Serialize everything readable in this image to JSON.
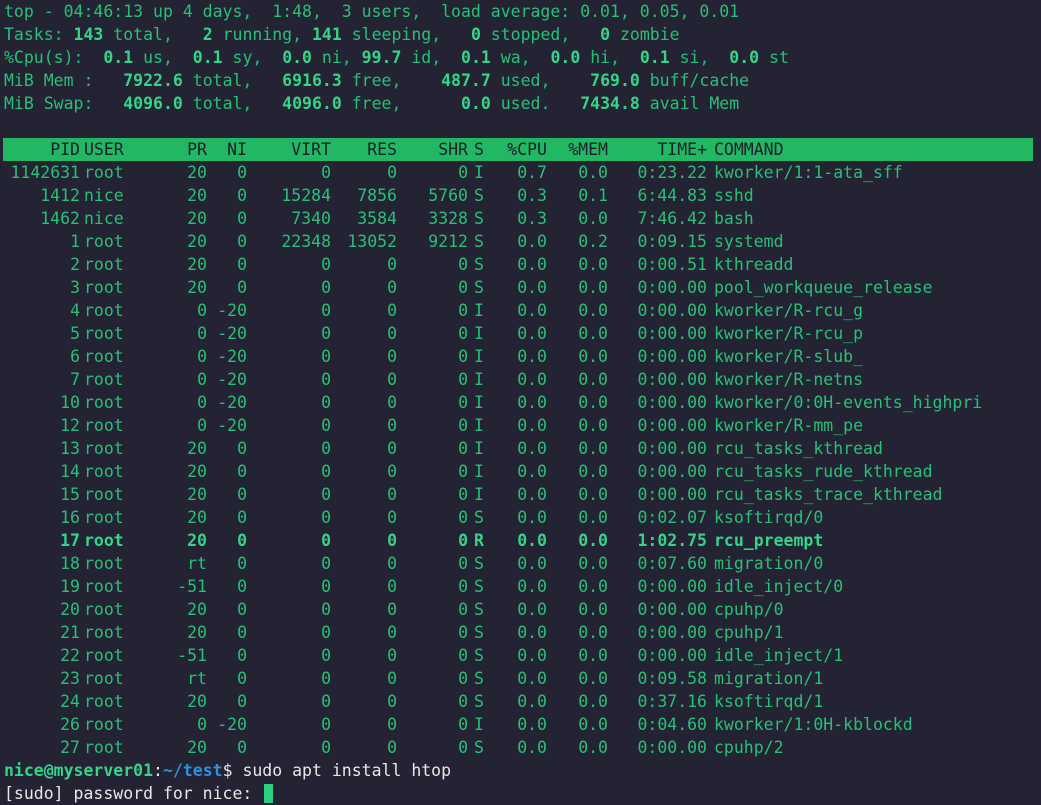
{
  "summary": {
    "line1": {
      "prefix": "top - 04:46:13 up 4 days,  1:48,  3 users,  load average: 0.01, 0.05, 0.01"
    },
    "line2": {
      "label": "Tasks:",
      "total": "143",
      "total_label": " total,   ",
      "running": "2",
      "running_label": " running, ",
      "sleeping": "141",
      "sleeping_label": " sleeping,   ",
      "stopped": "0",
      "stopped_label": " stopped,   ",
      "zombie": "0",
      "zombie_label": " zombie"
    },
    "line3": {
      "label": "%Cpu(s):  ",
      "us": "0.1",
      "us_label": " us,  ",
      "sy": "0.1",
      "sy_label": " sy,  ",
      "ni": "0.0",
      "ni_label": " ni, ",
      "id": "99.7",
      "id_label": " id,  ",
      "wa": "0.1",
      "wa_label": " wa,  ",
      "hi": "0.0",
      "hi_label": " hi,  ",
      "si": "0.1",
      "si_label": " si,  ",
      "st": "0.0",
      "st_label": " st"
    },
    "line4": {
      "label": "MiB Mem :   ",
      "total": "7922.6",
      "total_label": " total,   ",
      "free": "6916.3",
      "free_label": " free,    ",
      "used": "487.7",
      "used_label": " used,    ",
      "buff": "769.0",
      "buff_label": " buff/cache"
    },
    "line5": {
      "label": "MiB Swap:   ",
      "total": "4096.0",
      "total_label": " total,   ",
      "free": "4096.0",
      "free_label": " free,      ",
      "used": "0.0",
      "used_label": " used.   ",
      "avail": "7434.8",
      "avail_label": " avail Mem"
    }
  },
  "columns": [
    "PID",
    "USER",
    "PR",
    "NI",
    "VIRT",
    "RES",
    "SHR",
    "S",
    "%CPU",
    "%MEM",
    "TIME+",
    "COMMAND"
  ],
  "processes": [
    {
      "pid": "1142631",
      "user": "root",
      "pr": "20",
      "ni": "0",
      "virt": "0",
      "res": "0",
      "shr": "0",
      "s": "I",
      "cpu": "0.7",
      "mem": "0.0",
      "time": "0:23.22",
      "cmd": "kworker/1:1-ata_sff",
      "bold": false
    },
    {
      "pid": "1412",
      "user": "nice",
      "pr": "20",
      "ni": "0",
      "virt": "15284",
      "res": "7856",
      "shr": "5760",
      "s": "S",
      "cpu": "0.3",
      "mem": "0.1",
      "time": "6:44.83",
      "cmd": "sshd",
      "bold": false
    },
    {
      "pid": "1462",
      "user": "nice",
      "pr": "20",
      "ni": "0",
      "virt": "7340",
      "res": "3584",
      "shr": "3328",
      "s": "S",
      "cpu": "0.3",
      "mem": "0.0",
      "time": "7:46.42",
      "cmd": "bash",
      "bold": false
    },
    {
      "pid": "1",
      "user": "root",
      "pr": "20",
      "ni": "0",
      "virt": "22348",
      "res": "13052",
      "shr": "9212",
      "s": "S",
      "cpu": "0.0",
      "mem": "0.2",
      "time": "0:09.15",
      "cmd": "systemd",
      "bold": false
    },
    {
      "pid": "2",
      "user": "root",
      "pr": "20",
      "ni": "0",
      "virt": "0",
      "res": "0",
      "shr": "0",
      "s": "S",
      "cpu": "0.0",
      "mem": "0.0",
      "time": "0:00.51",
      "cmd": "kthreadd",
      "bold": false
    },
    {
      "pid": "3",
      "user": "root",
      "pr": "20",
      "ni": "0",
      "virt": "0",
      "res": "0",
      "shr": "0",
      "s": "S",
      "cpu": "0.0",
      "mem": "0.0",
      "time": "0:00.00",
      "cmd": "pool_workqueue_release",
      "bold": false
    },
    {
      "pid": "4",
      "user": "root",
      "pr": "0",
      "ni": "-20",
      "virt": "0",
      "res": "0",
      "shr": "0",
      "s": "I",
      "cpu": "0.0",
      "mem": "0.0",
      "time": "0:00.00",
      "cmd": "kworker/R-rcu_g",
      "bold": false
    },
    {
      "pid": "5",
      "user": "root",
      "pr": "0",
      "ni": "-20",
      "virt": "0",
      "res": "0",
      "shr": "0",
      "s": "I",
      "cpu": "0.0",
      "mem": "0.0",
      "time": "0:00.00",
      "cmd": "kworker/R-rcu_p",
      "bold": false
    },
    {
      "pid": "6",
      "user": "root",
      "pr": "0",
      "ni": "-20",
      "virt": "0",
      "res": "0",
      "shr": "0",
      "s": "I",
      "cpu": "0.0",
      "mem": "0.0",
      "time": "0:00.00",
      "cmd": "kworker/R-slub_",
      "bold": false
    },
    {
      "pid": "7",
      "user": "root",
      "pr": "0",
      "ni": "-20",
      "virt": "0",
      "res": "0",
      "shr": "0",
      "s": "I",
      "cpu": "0.0",
      "mem": "0.0",
      "time": "0:00.00",
      "cmd": "kworker/R-netns",
      "bold": false
    },
    {
      "pid": "10",
      "user": "root",
      "pr": "0",
      "ni": "-20",
      "virt": "0",
      "res": "0",
      "shr": "0",
      "s": "I",
      "cpu": "0.0",
      "mem": "0.0",
      "time": "0:00.00",
      "cmd": "kworker/0:0H-events_highpri",
      "bold": false
    },
    {
      "pid": "12",
      "user": "root",
      "pr": "0",
      "ni": "-20",
      "virt": "0",
      "res": "0",
      "shr": "0",
      "s": "I",
      "cpu": "0.0",
      "mem": "0.0",
      "time": "0:00.00",
      "cmd": "kworker/R-mm_pe",
      "bold": false
    },
    {
      "pid": "13",
      "user": "root",
      "pr": "20",
      "ni": "0",
      "virt": "0",
      "res": "0",
      "shr": "0",
      "s": "I",
      "cpu": "0.0",
      "mem": "0.0",
      "time": "0:00.00",
      "cmd": "rcu_tasks_kthread",
      "bold": false
    },
    {
      "pid": "14",
      "user": "root",
      "pr": "20",
      "ni": "0",
      "virt": "0",
      "res": "0",
      "shr": "0",
      "s": "I",
      "cpu": "0.0",
      "mem": "0.0",
      "time": "0:00.00",
      "cmd": "rcu_tasks_rude_kthread",
      "bold": false
    },
    {
      "pid": "15",
      "user": "root",
      "pr": "20",
      "ni": "0",
      "virt": "0",
      "res": "0",
      "shr": "0",
      "s": "I",
      "cpu": "0.0",
      "mem": "0.0",
      "time": "0:00.00",
      "cmd": "rcu_tasks_trace_kthread",
      "bold": false
    },
    {
      "pid": "16",
      "user": "root",
      "pr": "20",
      "ni": "0",
      "virt": "0",
      "res": "0",
      "shr": "0",
      "s": "S",
      "cpu": "0.0",
      "mem": "0.0",
      "time": "0:02.07",
      "cmd": "ksoftirqd/0",
      "bold": false
    },
    {
      "pid": "17",
      "user": "root",
      "pr": "20",
      "ni": "0",
      "virt": "0",
      "res": "0",
      "shr": "0",
      "s": "R",
      "cpu": "0.0",
      "mem": "0.0",
      "time": "1:02.75",
      "cmd": "rcu_preempt",
      "bold": true
    },
    {
      "pid": "18",
      "user": "root",
      "pr": "rt",
      "ni": "0",
      "virt": "0",
      "res": "0",
      "shr": "0",
      "s": "S",
      "cpu": "0.0",
      "mem": "0.0",
      "time": "0:07.60",
      "cmd": "migration/0",
      "bold": false
    },
    {
      "pid": "19",
      "user": "root",
      "pr": "-51",
      "ni": "0",
      "virt": "0",
      "res": "0",
      "shr": "0",
      "s": "S",
      "cpu": "0.0",
      "mem": "0.0",
      "time": "0:00.00",
      "cmd": "idle_inject/0",
      "bold": false
    },
    {
      "pid": "20",
      "user": "root",
      "pr": "20",
      "ni": "0",
      "virt": "0",
      "res": "0",
      "shr": "0",
      "s": "S",
      "cpu": "0.0",
      "mem": "0.0",
      "time": "0:00.00",
      "cmd": "cpuhp/0",
      "bold": false
    },
    {
      "pid": "21",
      "user": "root",
      "pr": "20",
      "ni": "0",
      "virt": "0",
      "res": "0",
      "shr": "0",
      "s": "S",
      "cpu": "0.0",
      "mem": "0.0",
      "time": "0:00.00",
      "cmd": "cpuhp/1",
      "bold": false
    },
    {
      "pid": "22",
      "user": "root",
      "pr": "-51",
      "ni": "0",
      "virt": "0",
      "res": "0",
      "shr": "0",
      "s": "S",
      "cpu": "0.0",
      "mem": "0.0",
      "time": "0:00.00",
      "cmd": "idle_inject/1",
      "bold": false
    },
    {
      "pid": "23",
      "user": "root",
      "pr": "rt",
      "ni": "0",
      "virt": "0",
      "res": "0",
      "shr": "0",
      "s": "S",
      "cpu": "0.0",
      "mem": "0.0",
      "time": "0:09.58",
      "cmd": "migration/1",
      "bold": false
    },
    {
      "pid": "24",
      "user": "root",
      "pr": "20",
      "ni": "0",
      "virt": "0",
      "res": "0",
      "shr": "0",
      "s": "S",
      "cpu": "0.0",
      "mem": "0.0",
      "time": "0:37.16",
      "cmd": "ksoftirqd/1",
      "bold": false
    },
    {
      "pid": "26",
      "user": "root",
      "pr": "0",
      "ni": "-20",
      "virt": "0",
      "res": "0",
      "shr": "0",
      "s": "I",
      "cpu": "0.0",
      "mem": "0.0",
      "time": "0:04.60",
      "cmd": "kworker/1:0H-kblockd",
      "bold": false
    },
    {
      "pid": "27",
      "user": "root",
      "pr": "20",
      "ni": "0",
      "virt": "0",
      "res": "0",
      "shr": "0",
      "s": "S",
      "cpu": "0.0",
      "mem": "0.0",
      "time": "0:00.00",
      "cmd": "cpuhp/2",
      "bold": false
    }
  ],
  "prompt": {
    "user_host": "nice@myserver01",
    "colon": ":",
    "path": "~/test",
    "dollar": "$ ",
    "command": "sudo apt install htop",
    "sudo_prompt": "[sudo] password for nice: "
  },
  "colors": {
    "background": "#232333",
    "text": "#28c076",
    "header_bar": "#21b763",
    "path": "#2f8fd8"
  }
}
